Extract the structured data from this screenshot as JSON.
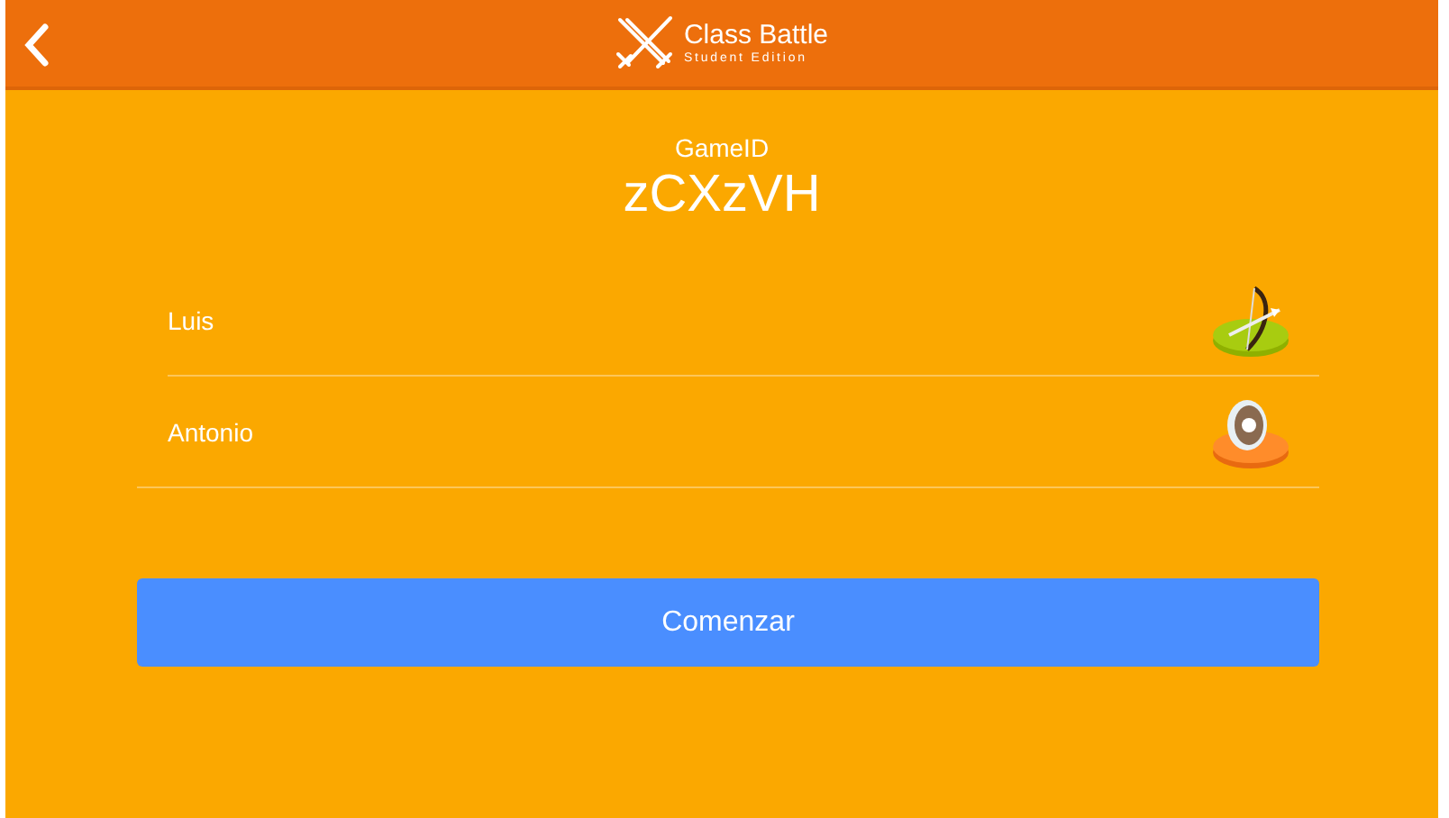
{
  "header": {
    "title": "Class Battle",
    "subtitle": "Student Edition"
  },
  "game": {
    "label": "GameID",
    "code": "zCXzVH"
  },
  "players": [
    {
      "name": "Luis",
      "kind": "bow"
    },
    {
      "name": "Antonio",
      "kind": "shield"
    }
  ],
  "start_button": "Comenzar"
}
